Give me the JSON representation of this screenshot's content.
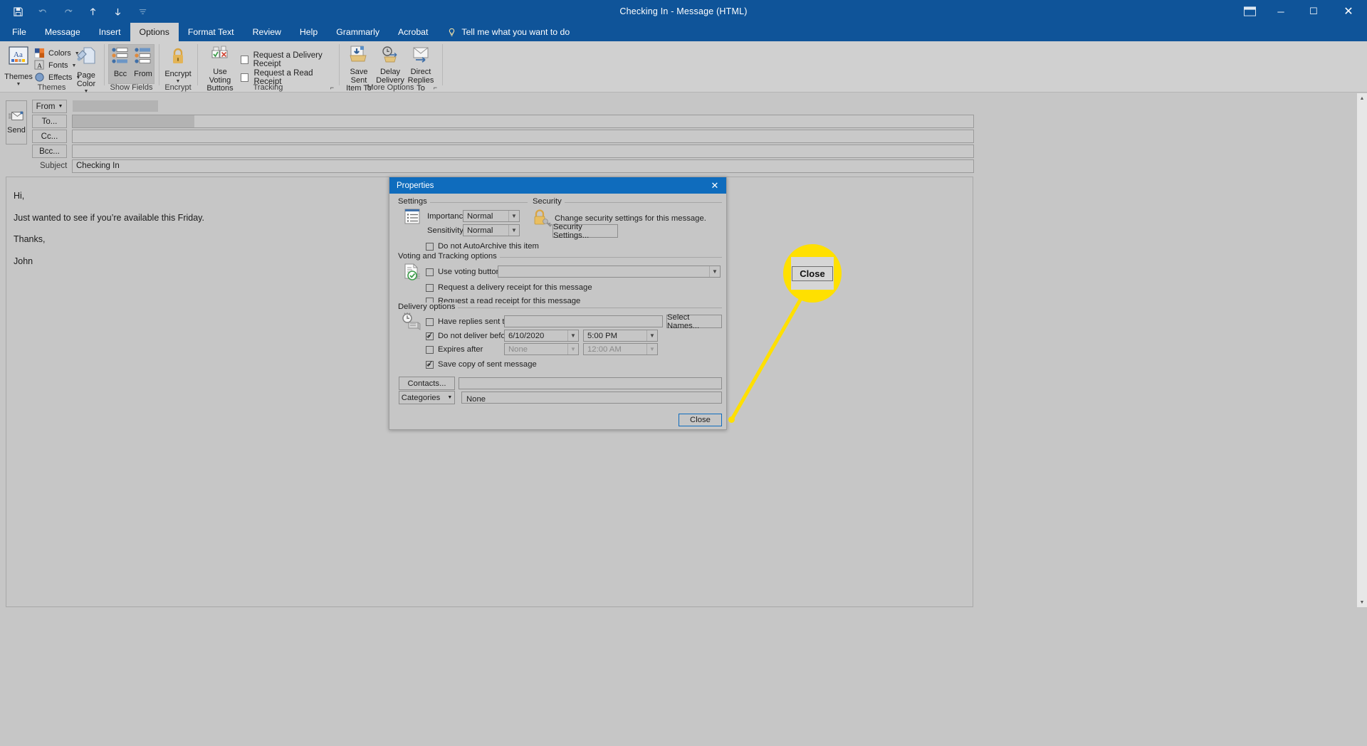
{
  "window": {
    "title": "Checking In  -  Message (HTML)",
    "quick_access": [
      "save-icon",
      "undo-icon",
      "redo-icon",
      "up-icon",
      "down-icon",
      "customize-qat-icon"
    ],
    "controls": {
      "ribbon_display": "ribbon-display-icon",
      "minimize": "─",
      "maximize": "☐",
      "close": "✕"
    }
  },
  "tabs": [
    {
      "label": "File",
      "active": false
    },
    {
      "label": "Message",
      "active": false
    },
    {
      "label": "Insert",
      "active": false
    },
    {
      "label": "Options",
      "active": true
    },
    {
      "label": "Format Text",
      "active": false
    },
    {
      "label": "Review",
      "active": false
    },
    {
      "label": "Help",
      "active": false
    },
    {
      "label": "Grammarly",
      "active": false
    },
    {
      "label": "Acrobat",
      "active": false
    }
  ],
  "tell_me": "Tell me what you want to do",
  "ribbon": {
    "groups": [
      {
        "name": "Themes",
        "label": "Themes"
      },
      {
        "name": "Show Fields",
        "label": "Show Fields"
      },
      {
        "name": "Encrypt",
        "label": "Encrypt"
      },
      {
        "name": "Tracking",
        "label": "Tracking"
      },
      {
        "name": "More Options",
        "label": "More Options"
      }
    ],
    "themes_button": "Themes",
    "colors": "Colors",
    "fonts": "Fonts",
    "effects": "Effects",
    "page_color": "Page Color",
    "bcc": "Bcc",
    "from": "From",
    "encrypt": "Encrypt",
    "use_voting_buttons": "Use Voting Buttons",
    "request_delivery_receipt": "Request a Delivery Receipt",
    "request_read_receipt": "Request a Read Receipt",
    "save_sent_item_to": "Save Sent Item To",
    "delay_delivery": "Delay Delivery",
    "direct_replies_to": "Direct Replies To"
  },
  "compose": {
    "send": "Send",
    "from": "From",
    "to": "To...",
    "cc": "Cc...",
    "bcc": "Bcc...",
    "subject_label": "Subject",
    "subject_value": "Checking In",
    "body_lines": [
      "Hi,",
      "",
      "Just wanted to see if you’re available this Friday.",
      "",
      "Thanks,",
      "",
      "John"
    ]
  },
  "dialog": {
    "title": "Properties",
    "close_icon": "✕",
    "settings": {
      "caption": "Settings",
      "importance_label": "Importance",
      "importance_value": "Normal",
      "sensitivity_label": "Sensitivity",
      "sensitivity_value": "Normal",
      "autoarchive_label": "Do not AutoArchive this item",
      "autoarchive_checked": false
    },
    "security": {
      "caption": "Security",
      "description": "Change security settings for this message.",
      "button": "Security Settings..."
    },
    "voting": {
      "caption": "Voting and Tracking options",
      "use_voting_label": "Use voting buttons",
      "use_voting_checked": false,
      "voting_value": "",
      "delivery_receipt_label": "Request a delivery receipt for this message",
      "delivery_receipt_checked": false,
      "read_receipt_label": "Request a read receipt for this message",
      "read_receipt_checked": false
    },
    "delivery": {
      "caption": "Delivery options",
      "have_replies_label": "Have replies sent to",
      "have_replies_checked": false,
      "have_replies_value": "",
      "select_names_button": "Select Names...",
      "do_not_deliver_label": "Do not deliver before",
      "do_not_deliver_checked": true,
      "do_not_deliver_date": "6/10/2020",
      "do_not_deliver_time": "5:00 PM",
      "expires_label": "Expires after",
      "expires_checked": false,
      "expires_date": "None",
      "expires_time": "12:00 AM",
      "save_copy_label": "Save copy of sent message",
      "save_copy_checked": true,
      "contacts_button": "Contacts...",
      "contacts_value": "",
      "categories_button": "Categories",
      "categories_value": "None"
    },
    "close_button": "Close"
  },
  "callout": {
    "button_label": "Close",
    "highlight_color": "#ffe000"
  }
}
